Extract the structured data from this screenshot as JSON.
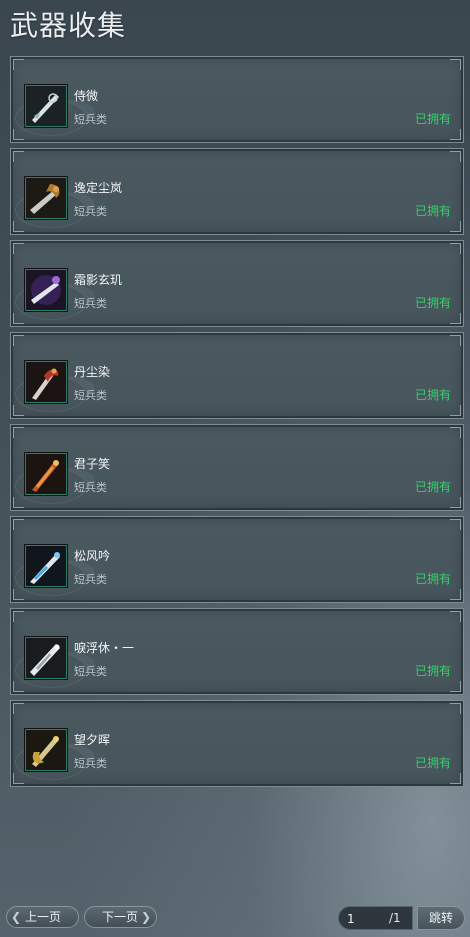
{
  "header": {
    "title": "武器收集"
  },
  "weapons": [
    {
      "name": "侍微",
      "type": "短兵类",
      "status": "已拥有",
      "icon": "silver-blade-icon"
    },
    {
      "name": "逸定尘岚",
      "type": "短兵类",
      "status": "已拥有",
      "icon": "bronze-blade-icon"
    },
    {
      "name": "霜影玄玑",
      "type": "短兵类",
      "status": "已拥有",
      "icon": "purple-blade-icon"
    },
    {
      "name": "丹尘染",
      "type": "短兵类",
      "status": "已拥有",
      "icon": "red-blade-icon"
    },
    {
      "name": "君子笑",
      "type": "短兵类",
      "status": "已拥有",
      "icon": "orange-blade-icon"
    },
    {
      "name": "松风吟",
      "type": "短兵类",
      "status": "已拥有",
      "icon": "blue-blade-icon"
    },
    {
      "name": "唳浮休・一",
      "type": "短兵类",
      "status": "已拥有",
      "icon": "white-blade-icon"
    },
    {
      "name": "望夕晖",
      "type": "短兵类",
      "status": "已拥有",
      "icon": "gold-blade-icon"
    }
  ],
  "pager": {
    "prev_label": "上一页",
    "next_label": "下一页",
    "current_page": "1",
    "total_pages": "/1",
    "jump_label": "跳转"
  },
  "colors": {
    "owned": "#36d06a",
    "accent_frame": "#2f7b66"
  }
}
